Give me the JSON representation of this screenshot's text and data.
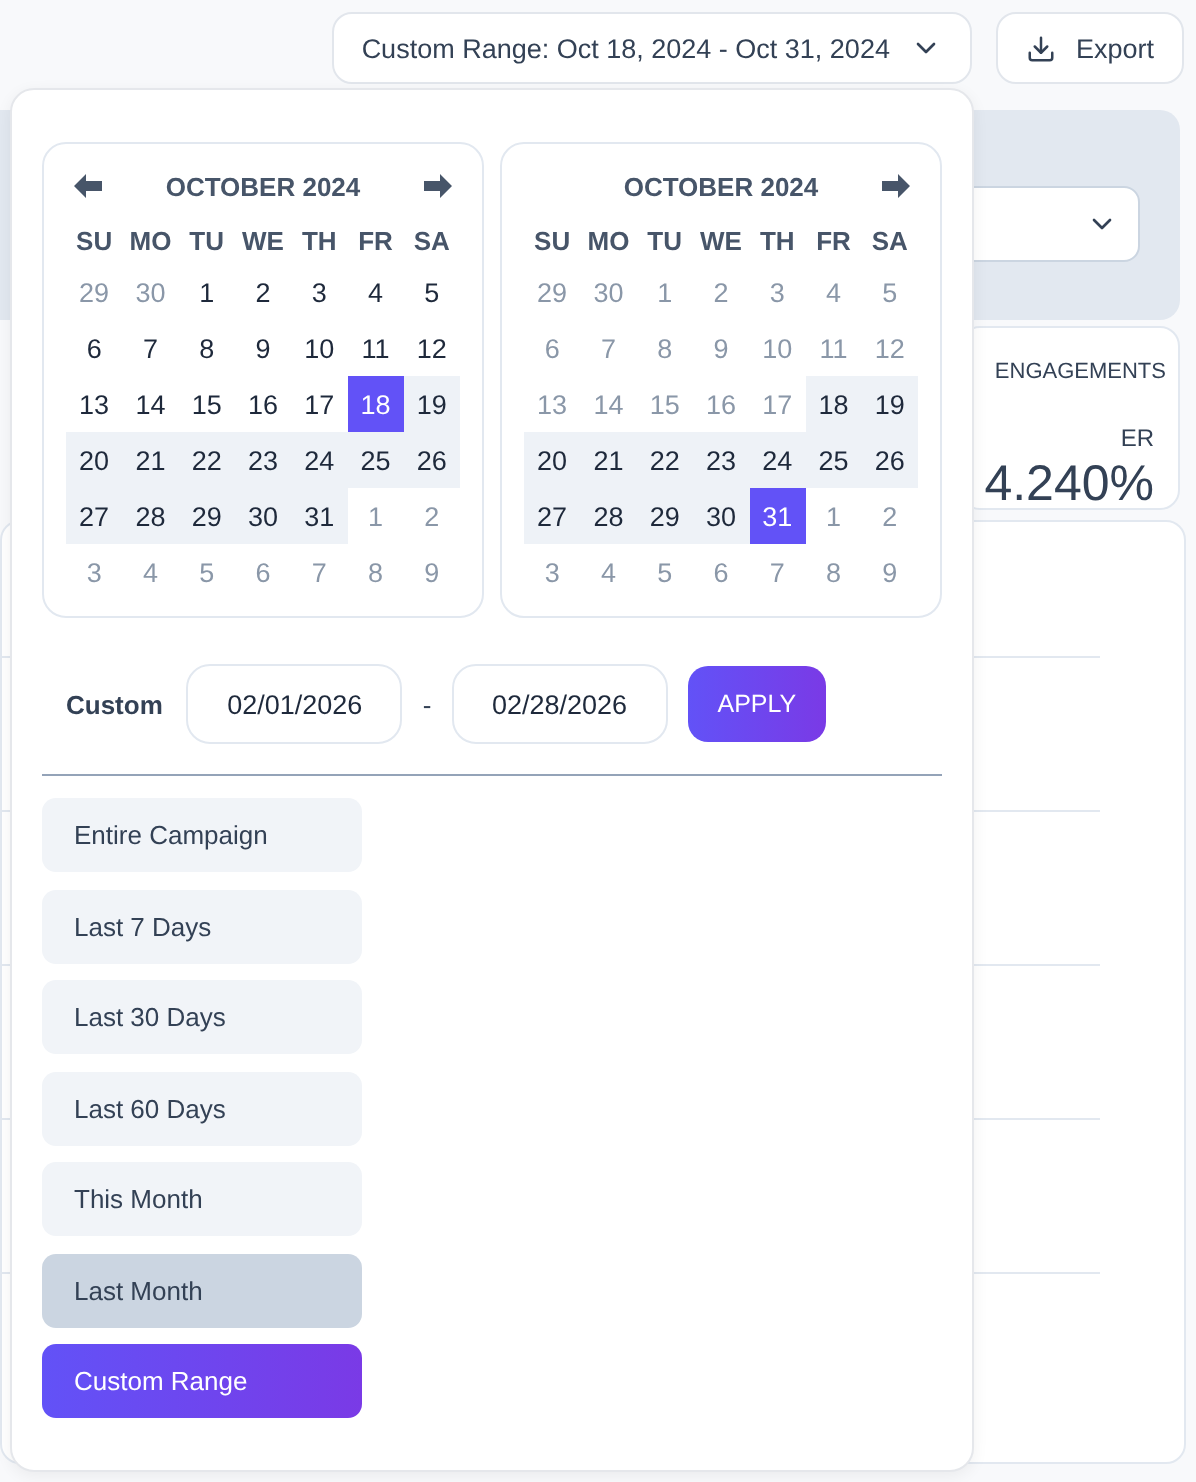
{
  "toolbar": {
    "range_button": {
      "label": "Custom Range: Oct 18, 2024 - Oct 31, 2024"
    },
    "export_button": {
      "label": "Export"
    }
  },
  "stat_card": {
    "title": "ENGAGEMENTS",
    "label": "ER",
    "value": "4.240%"
  },
  "date_picker": {
    "calendars": [
      {
        "title": "OCTOBER 2024",
        "prev": true,
        "next": true,
        "weekdays": [
          "SU",
          "MO",
          "TU",
          "WE",
          "TH",
          "FR",
          "SA"
        ],
        "days": [
          {
            "label": "29",
            "muted": true,
            "in_range": false,
            "selected": false
          },
          {
            "label": "30",
            "muted": true,
            "in_range": false,
            "selected": false
          },
          {
            "label": "1",
            "muted": false,
            "in_range": false,
            "selected": false
          },
          {
            "label": "2",
            "muted": false,
            "in_range": false,
            "selected": false
          },
          {
            "label": "3",
            "muted": false,
            "in_range": false,
            "selected": false
          },
          {
            "label": "4",
            "muted": false,
            "in_range": false,
            "selected": false
          },
          {
            "label": "5",
            "muted": false,
            "in_range": false,
            "selected": false
          },
          {
            "label": "6",
            "muted": false,
            "in_range": false,
            "selected": false
          },
          {
            "label": "7",
            "muted": false,
            "in_range": false,
            "selected": false
          },
          {
            "label": "8",
            "muted": false,
            "in_range": false,
            "selected": false
          },
          {
            "label": "9",
            "muted": false,
            "in_range": false,
            "selected": false
          },
          {
            "label": "10",
            "muted": false,
            "in_range": false,
            "selected": false
          },
          {
            "label": "11",
            "muted": false,
            "in_range": false,
            "selected": false
          },
          {
            "label": "12",
            "muted": false,
            "in_range": false,
            "selected": false
          },
          {
            "label": "13",
            "muted": false,
            "in_range": false,
            "selected": false
          },
          {
            "label": "14",
            "muted": false,
            "in_range": false,
            "selected": false
          },
          {
            "label": "15",
            "muted": false,
            "in_range": false,
            "selected": false
          },
          {
            "label": "16",
            "muted": false,
            "in_range": false,
            "selected": false
          },
          {
            "label": "17",
            "muted": false,
            "in_range": false,
            "selected": false
          },
          {
            "label": "18",
            "muted": false,
            "in_range": true,
            "selected": true
          },
          {
            "label": "19",
            "muted": false,
            "in_range": true,
            "selected": false
          },
          {
            "label": "20",
            "muted": false,
            "in_range": true,
            "selected": false
          },
          {
            "label": "21",
            "muted": false,
            "in_range": true,
            "selected": false
          },
          {
            "label": "22",
            "muted": false,
            "in_range": true,
            "selected": false
          },
          {
            "label": "23",
            "muted": false,
            "in_range": true,
            "selected": false
          },
          {
            "label": "24",
            "muted": false,
            "in_range": true,
            "selected": false
          },
          {
            "label": "25",
            "muted": false,
            "in_range": true,
            "selected": false
          },
          {
            "label": "26",
            "muted": false,
            "in_range": true,
            "selected": false
          },
          {
            "label": "27",
            "muted": false,
            "in_range": true,
            "selected": false
          },
          {
            "label": "28",
            "muted": false,
            "in_range": true,
            "selected": false
          },
          {
            "label": "29",
            "muted": false,
            "in_range": true,
            "selected": false
          },
          {
            "label": "30",
            "muted": false,
            "in_range": true,
            "selected": false
          },
          {
            "label": "31",
            "muted": false,
            "in_range": true,
            "selected": false
          },
          {
            "label": "1",
            "muted": true,
            "in_range": false,
            "selected": false
          },
          {
            "label": "2",
            "muted": true,
            "in_range": false,
            "selected": false
          },
          {
            "label": "3",
            "muted": true,
            "in_range": false,
            "selected": false
          },
          {
            "label": "4",
            "muted": true,
            "in_range": false,
            "selected": false
          },
          {
            "label": "5",
            "muted": true,
            "in_range": false,
            "selected": false
          },
          {
            "label": "6",
            "muted": true,
            "in_range": false,
            "selected": false
          },
          {
            "label": "7",
            "muted": true,
            "in_range": false,
            "selected": false
          },
          {
            "label": "8",
            "muted": true,
            "in_range": false,
            "selected": false
          },
          {
            "label": "9",
            "muted": true,
            "in_range": false,
            "selected": false
          }
        ]
      },
      {
        "title": "OCTOBER 2024",
        "prev": false,
        "next": true,
        "weekdays": [
          "SU",
          "MO",
          "TU",
          "WE",
          "TH",
          "FR",
          "SA"
        ],
        "days": [
          {
            "label": "29",
            "muted": true,
            "in_range": false,
            "selected": false
          },
          {
            "label": "30",
            "muted": true,
            "in_range": false,
            "selected": false
          },
          {
            "label": "1",
            "muted": true,
            "in_range": false,
            "selected": false
          },
          {
            "label": "2",
            "muted": true,
            "in_range": false,
            "selected": false
          },
          {
            "label": "3",
            "muted": true,
            "in_range": false,
            "selected": false
          },
          {
            "label": "4",
            "muted": true,
            "in_range": false,
            "selected": false
          },
          {
            "label": "5",
            "muted": true,
            "in_range": false,
            "selected": false
          },
          {
            "label": "6",
            "muted": true,
            "in_range": false,
            "selected": false
          },
          {
            "label": "7",
            "muted": true,
            "in_range": false,
            "selected": false
          },
          {
            "label": "8",
            "muted": true,
            "in_range": false,
            "selected": false
          },
          {
            "label": "9",
            "muted": true,
            "in_range": false,
            "selected": false
          },
          {
            "label": "10",
            "muted": true,
            "in_range": false,
            "selected": false
          },
          {
            "label": "11",
            "muted": true,
            "in_range": false,
            "selected": false
          },
          {
            "label": "12",
            "muted": true,
            "in_range": false,
            "selected": false
          },
          {
            "label": "13",
            "muted": true,
            "in_range": false,
            "selected": false
          },
          {
            "label": "14",
            "muted": true,
            "in_range": false,
            "selected": false
          },
          {
            "label": "15",
            "muted": true,
            "in_range": false,
            "selected": false
          },
          {
            "label": "16",
            "muted": true,
            "in_range": false,
            "selected": false
          },
          {
            "label": "17",
            "muted": true,
            "in_range": false,
            "selected": false
          },
          {
            "label": "18",
            "muted": false,
            "in_range": true,
            "selected": false
          },
          {
            "label": "19",
            "muted": false,
            "in_range": true,
            "selected": false
          },
          {
            "label": "20",
            "muted": false,
            "in_range": true,
            "selected": false
          },
          {
            "label": "21",
            "muted": false,
            "in_range": true,
            "selected": false
          },
          {
            "label": "22",
            "muted": false,
            "in_range": true,
            "selected": false
          },
          {
            "label": "23",
            "muted": false,
            "in_range": true,
            "selected": false
          },
          {
            "label": "24",
            "muted": false,
            "in_range": true,
            "selected": false
          },
          {
            "label": "25",
            "muted": false,
            "in_range": true,
            "selected": false
          },
          {
            "label": "26",
            "muted": false,
            "in_range": true,
            "selected": false
          },
          {
            "label": "27",
            "muted": false,
            "in_range": true,
            "selected": false
          },
          {
            "label": "28",
            "muted": false,
            "in_range": true,
            "selected": false
          },
          {
            "label": "29",
            "muted": false,
            "in_range": true,
            "selected": false
          },
          {
            "label": "30",
            "muted": false,
            "in_range": true,
            "selected": false
          },
          {
            "label": "31",
            "muted": false,
            "in_range": true,
            "selected": true
          },
          {
            "label": "1",
            "muted": true,
            "in_range": false,
            "selected": false
          },
          {
            "label": "2",
            "muted": true,
            "in_range": false,
            "selected": false
          },
          {
            "label": "3",
            "muted": true,
            "in_range": false,
            "selected": false
          },
          {
            "label": "4",
            "muted": true,
            "in_range": false,
            "selected": false
          },
          {
            "label": "5",
            "muted": true,
            "in_range": false,
            "selected": false
          },
          {
            "label": "6",
            "muted": true,
            "in_range": false,
            "selected": false
          },
          {
            "label": "7",
            "muted": true,
            "in_range": false,
            "selected": false
          },
          {
            "label": "8",
            "muted": true,
            "in_range": false,
            "selected": false
          },
          {
            "label": "9",
            "muted": true,
            "in_range": false,
            "selected": false
          }
        ]
      }
    ],
    "custom": {
      "label": "Custom",
      "start": "02/01/2026",
      "separator": "-",
      "end": "02/28/2026",
      "apply": "APPLY"
    },
    "presets": [
      {
        "label": "Entire Campaign",
        "selected": false,
        "highlighted": false
      },
      {
        "label": "Last 7 Days",
        "selected": false,
        "highlighted": false
      },
      {
        "label": "Last 30 Days",
        "selected": false,
        "highlighted": false
      },
      {
        "label": "Last 60 Days",
        "selected": false,
        "highlighted": false
      },
      {
        "label": "This Month",
        "selected": false,
        "highlighted": false
      },
      {
        "label": "Last Month",
        "selected": false,
        "highlighted": true
      },
      {
        "label": "Custom Range",
        "selected": true,
        "highlighted": false
      }
    ]
  }
}
